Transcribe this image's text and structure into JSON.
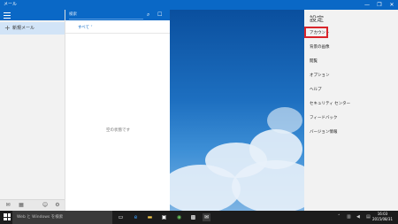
{
  "window": {
    "title": "メール",
    "minimize_glyph": "—",
    "maximize_glyph": "❐",
    "close_glyph": "✕"
  },
  "left_pane": {
    "new_mail_icon": "+",
    "new_mail_label": "新規メール"
  },
  "list_pane": {
    "search_placeholder": "検索",
    "filter_label": "すべて ˅",
    "empty_message": "空の状態です"
  },
  "settings": {
    "heading": "設定",
    "items": [
      "アカウント",
      "背景の画像",
      "閲覧",
      "オプション",
      "ヘルプ",
      "セキュリティ センター",
      "フィードバック",
      "バージョン情報"
    ]
  },
  "taskbar": {
    "search_text": "Web と Windows を検索",
    "time": "16:03",
    "date": "2015/08/31"
  },
  "colors": {
    "accent": "#0a68c6",
    "highlight": "#d9252b"
  }
}
